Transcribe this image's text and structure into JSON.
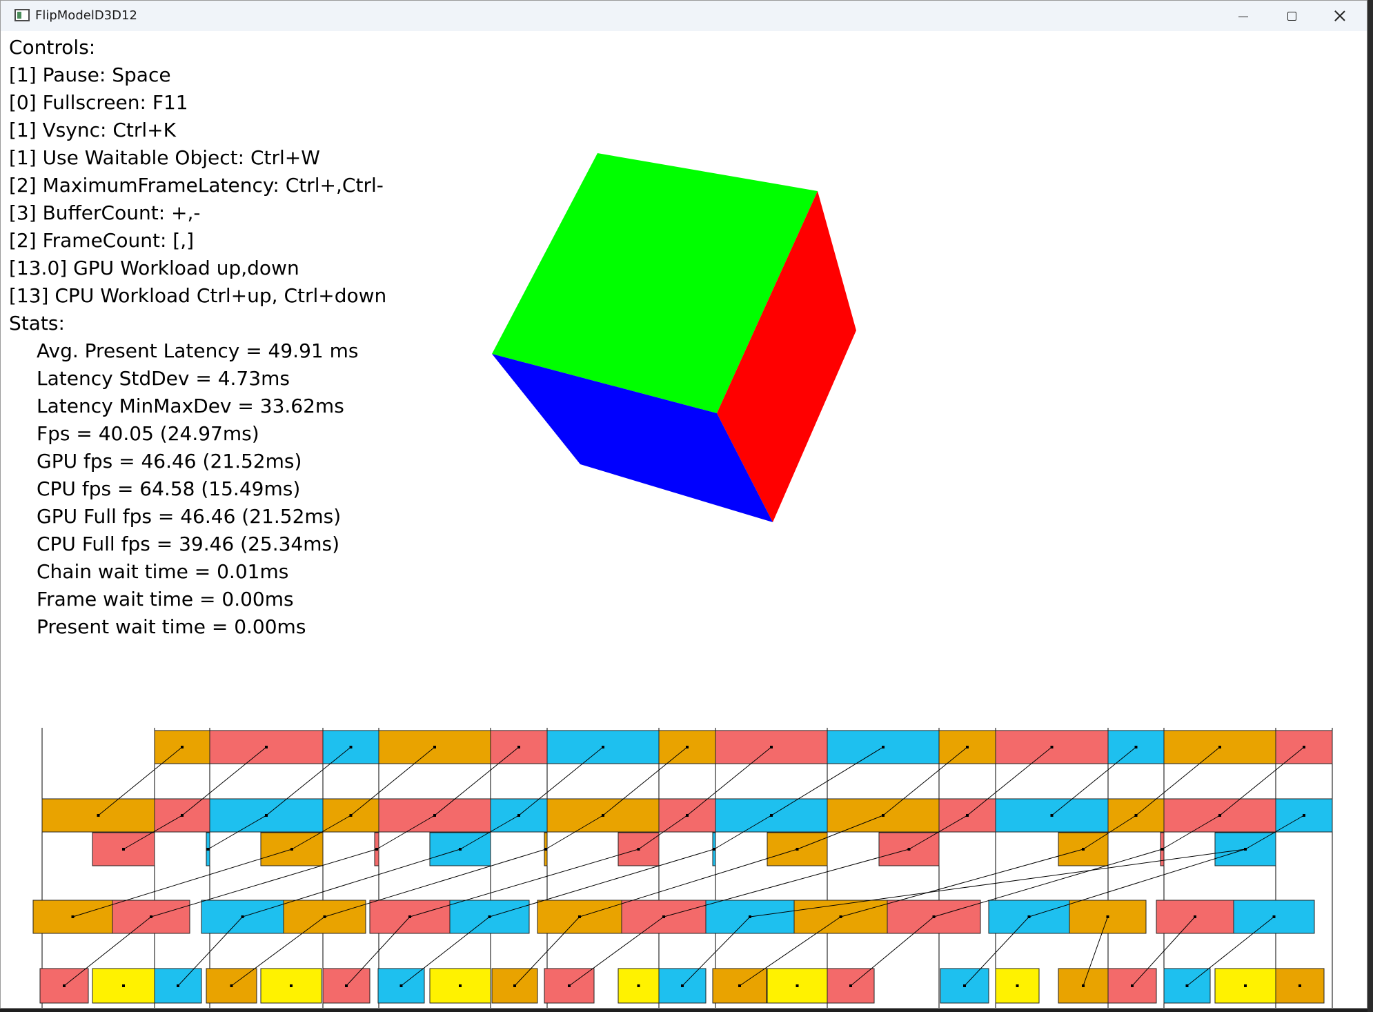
{
  "window": {
    "title": "FlipModelD3D12"
  },
  "controls": {
    "heading": "Controls:",
    "lines": [
      "[1] Pause: Space",
      "[0] Fullscreen: F11",
      "[1] Vsync: Ctrl+K",
      "[1] Use Waitable Object: Ctrl+W",
      "[2] MaximumFrameLatency: Ctrl+,Ctrl-",
      "[3] BufferCount: +,-",
      "[2] FrameCount: [,]",
      "[13.0] GPU Workload up,down",
      "[13] CPU Workload Ctrl+up, Ctrl+down"
    ]
  },
  "stats": {
    "heading": "Stats:",
    "lines": [
      "Avg. Present Latency = 49.91 ms",
      "Latency StdDev = 4.73ms",
      "Latency MinMaxDev = 33.62ms",
      "Fps = 40.05 (24.97ms)",
      "GPU fps = 46.46 (21.52ms)",
      "CPU fps = 64.58 (15.49ms)",
      "GPU Full fps = 46.46 (21.52ms)",
      "CPU Full fps = 39.46 (25.34ms)",
      "Chain wait time = 0.01ms",
      "Frame wait time = 0.00ms",
      "Present wait time = 0.00ms"
    ]
  },
  "cube": {
    "top_color": "#00ff00",
    "right_color": "#ff0000",
    "left_color": "#0000ff"
  },
  "timeline": {
    "colors": {
      "orange": "#e9a300",
      "red": "#f36a6a",
      "blue": "#1ec0ef",
      "yellow": "#fff200"
    },
    "rows": [
      {
        "name": "present-row",
        "segments": [
          [
            "orange",
            223,
            303
          ],
          [
            "red",
            303,
            467
          ],
          [
            "blue",
            467,
            548
          ],
          [
            "orange",
            548,
            710
          ],
          [
            "red",
            710,
            792
          ],
          [
            "blue",
            792,
            954
          ],
          [
            "orange",
            954,
            1036
          ],
          [
            "red",
            1036,
            1198
          ],
          [
            "blue",
            1198,
            1360
          ],
          [
            "orange",
            1360,
            1442
          ],
          [
            "red",
            1442,
            1605
          ],
          [
            "blue",
            1605,
            1686
          ],
          [
            "orange",
            1686,
            1848
          ],
          [
            "red",
            1848,
            1930
          ]
        ]
      },
      {
        "name": "queue-row",
        "segments": [
          [
            "orange",
            60,
            223
          ],
          [
            "red",
            223,
            303
          ],
          [
            "blue",
            303,
            467
          ],
          [
            "orange",
            467,
            548
          ],
          [
            "red",
            548,
            710
          ],
          [
            "blue",
            710,
            792
          ],
          [
            "orange",
            792,
            954
          ],
          [
            "red",
            954,
            1036
          ],
          [
            "blue",
            1036,
            1198
          ],
          [
            "orange",
            1198,
            1360
          ],
          [
            "red",
            1360,
            1442
          ],
          [
            "blue",
            1442,
            1605
          ],
          [
            "orange",
            1605,
            1686
          ],
          [
            "red",
            1686,
            1848
          ],
          [
            "blue",
            1848,
            1930
          ]
        ]
      },
      {
        "name": "gpu-row",
        "segments": [
          [
            "red",
            133,
            223
          ],
          [
            "blue",
            298,
            303
          ],
          [
            "orange",
            377,
            467
          ],
          [
            "red",
            542,
            548
          ],
          [
            "blue",
            622,
            710
          ],
          [
            "orange",
            788,
            792
          ],
          [
            "red",
            895,
            954
          ],
          [
            "blue",
            1032,
            1036
          ],
          [
            "orange",
            1111,
            1198
          ],
          [
            "red",
            1273,
            1360
          ],
          [
            "orange",
            1533,
            1605
          ],
          [
            "red",
            1681,
            1686
          ],
          [
            "blue",
            1760,
            1848
          ]
        ]
      },
      {
        "name": "submit-row",
        "segments": [
          [
            "orange",
            47,
            162
          ],
          [
            "red",
            162,
            274
          ],
          [
            "blue",
            291,
            410
          ],
          [
            "orange",
            410,
            529
          ],
          [
            "red",
            535,
            651
          ],
          [
            "blue",
            651,
            766
          ],
          [
            "orange",
            778,
            900
          ],
          [
            "red",
            900,
            1022
          ],
          [
            "blue",
            1022,
            1150
          ],
          [
            "orange",
            1150,
            1285
          ],
          [
            "red",
            1285,
            1420
          ],
          [
            "blue",
            1432,
            1549
          ],
          [
            "orange",
            1549,
            1660
          ],
          [
            "red",
            1675,
            1787
          ],
          [
            "blue",
            1787,
            1904
          ]
        ]
      },
      {
        "name": "cpu-row",
        "segments": [
          [
            "red",
            57,
            127
          ],
          [
            "yellow",
            133,
            223
          ],
          [
            "blue",
            223,
            291
          ],
          [
            "orange",
            298,
            371
          ],
          [
            "yellow",
            377,
            465
          ],
          [
            "red",
            467,
            535
          ],
          [
            "blue",
            547,
            614
          ],
          [
            "yellow",
            622,
            710
          ],
          [
            "orange",
            712,
            778
          ],
          [
            "red",
            788,
            860
          ],
          [
            "yellow",
            895,
            954
          ],
          [
            "blue",
            954,
            1022
          ],
          [
            "orange",
            1032,
            1110
          ],
          [
            "yellow",
            1111,
            1198
          ],
          [
            "red",
            1198,
            1266
          ],
          [
            "blue",
            1362,
            1432
          ],
          [
            "yellow",
            1442,
            1505
          ],
          [
            "orange",
            1533,
            1605
          ],
          [
            "red",
            1605,
            1675
          ],
          [
            "blue",
            1686,
            1753
          ],
          [
            "yellow",
            1760,
            1848
          ],
          [
            "orange",
            1848,
            1918
          ]
        ]
      }
    ],
    "vlines": [
      60,
      223,
      303,
      467,
      548,
      710,
      792,
      954,
      1036,
      1198,
      1360,
      1442,
      1605,
      1686,
      1848,
      1930
    ]
  }
}
